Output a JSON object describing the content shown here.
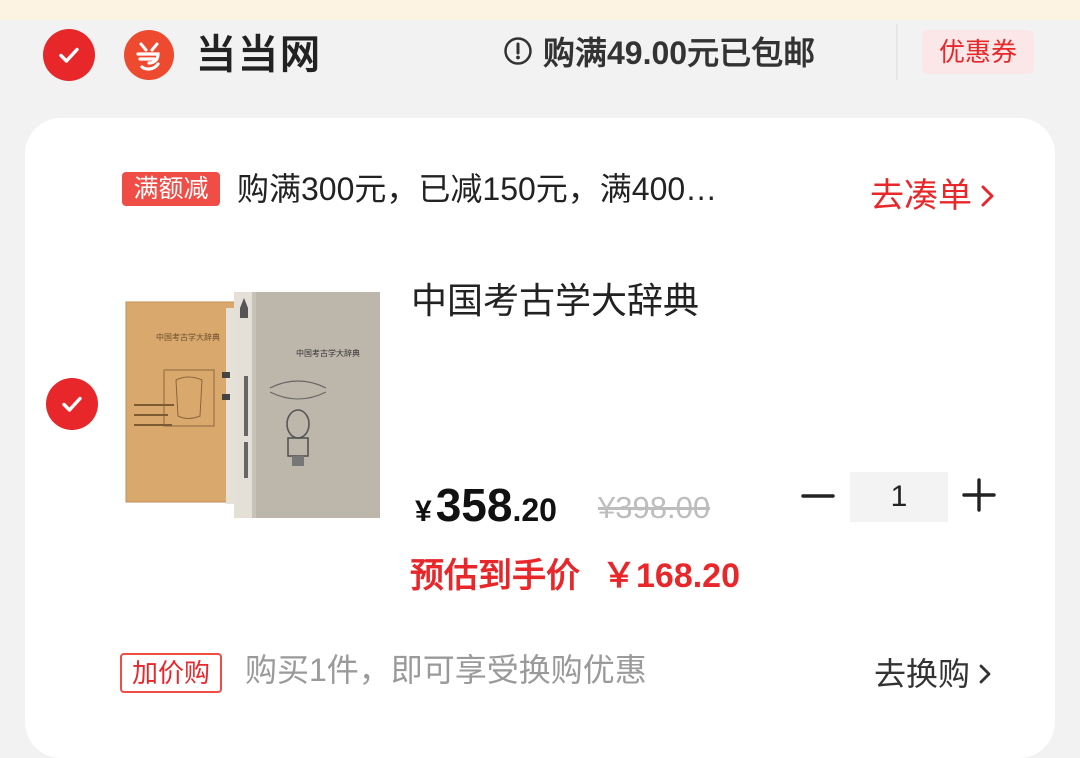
{
  "header": {
    "store_name": "当当网",
    "shipping_text": "购满49.00元已包邮",
    "coupon_label": "优惠券"
  },
  "promo": {
    "tag": "满额减",
    "text": "购满300元，已减150元，满400…",
    "link": "去凑单"
  },
  "item": {
    "title": "中国考古学大辞典",
    "price_symbol": "¥",
    "price_int": "358",
    "price_dec": ".20",
    "original_price": "¥398.00",
    "quantity": "1",
    "estimate_label": "预估到手价",
    "estimate_value": "￥168.20",
    "cover_title": "中国考古学大辞典"
  },
  "addon": {
    "tag": "加价购",
    "text": "购买1件，即可享受换购优惠",
    "link": "去换购"
  },
  "colors": {
    "accent": "#e8272a",
    "logo": "#ee4a2f",
    "background": "#f2f2f2"
  }
}
